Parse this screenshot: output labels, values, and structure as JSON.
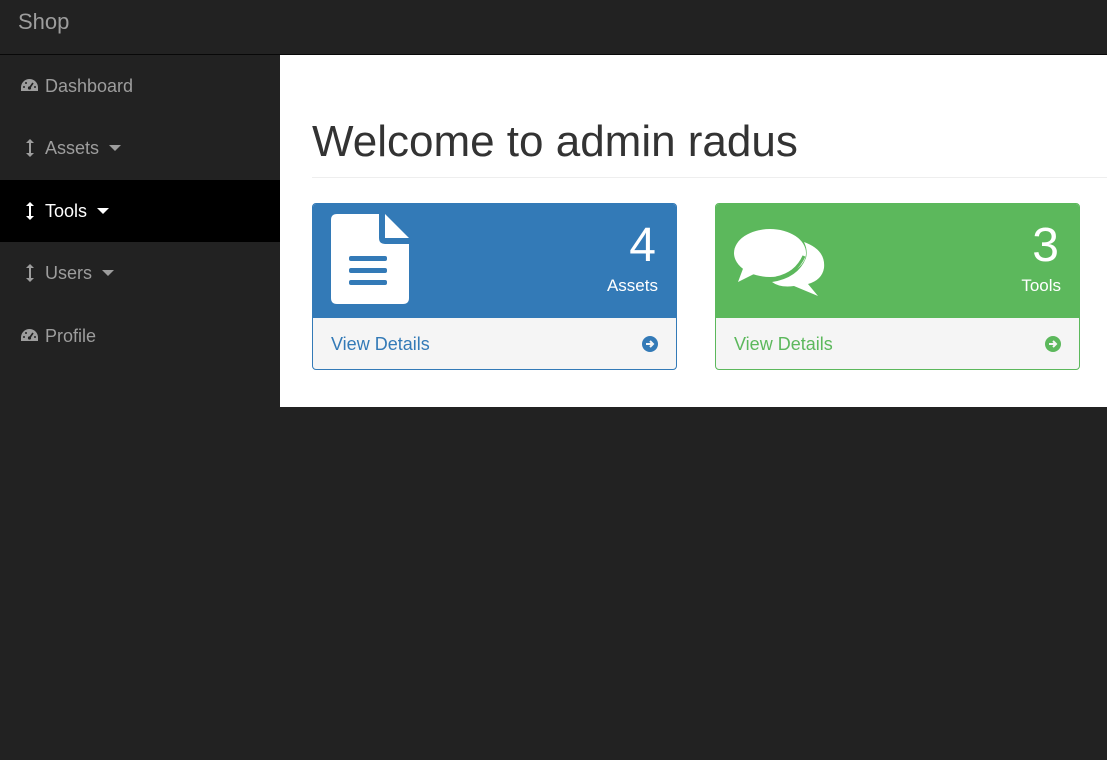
{
  "app": {
    "brand": "Shop"
  },
  "sidebar": {
    "items": [
      {
        "label": "Dashboard",
        "icon": "dashboard-icon",
        "has_caret": false,
        "active": false
      },
      {
        "label": "Assets",
        "icon": "arrows-vertical-icon",
        "has_caret": true,
        "active": false
      },
      {
        "label": "Tools",
        "icon": "arrows-vertical-icon",
        "has_caret": true,
        "active": true
      },
      {
        "label": "Users",
        "icon": "arrows-vertical-icon",
        "has_caret": true,
        "active": false
      },
      {
        "label": "Profile",
        "icon": "dashboard-icon",
        "has_caret": false,
        "active": false
      }
    ]
  },
  "main": {
    "title": "Welcome to admin radus",
    "panels": [
      {
        "count": "4",
        "label": "Assets",
        "footer": "View Details",
        "icon": "file-text-icon",
        "color": "#337ab7"
      },
      {
        "count": "3",
        "label": "Tools",
        "footer": "View Details",
        "icon": "comments-icon",
        "color": "#5cb85c"
      }
    ]
  },
  "colors": {
    "navbar_bg": "#222222",
    "sidebar_text": "#9d9d9d",
    "active_bg": "#000000",
    "primary": "#337ab7",
    "success": "#5cb85c"
  }
}
